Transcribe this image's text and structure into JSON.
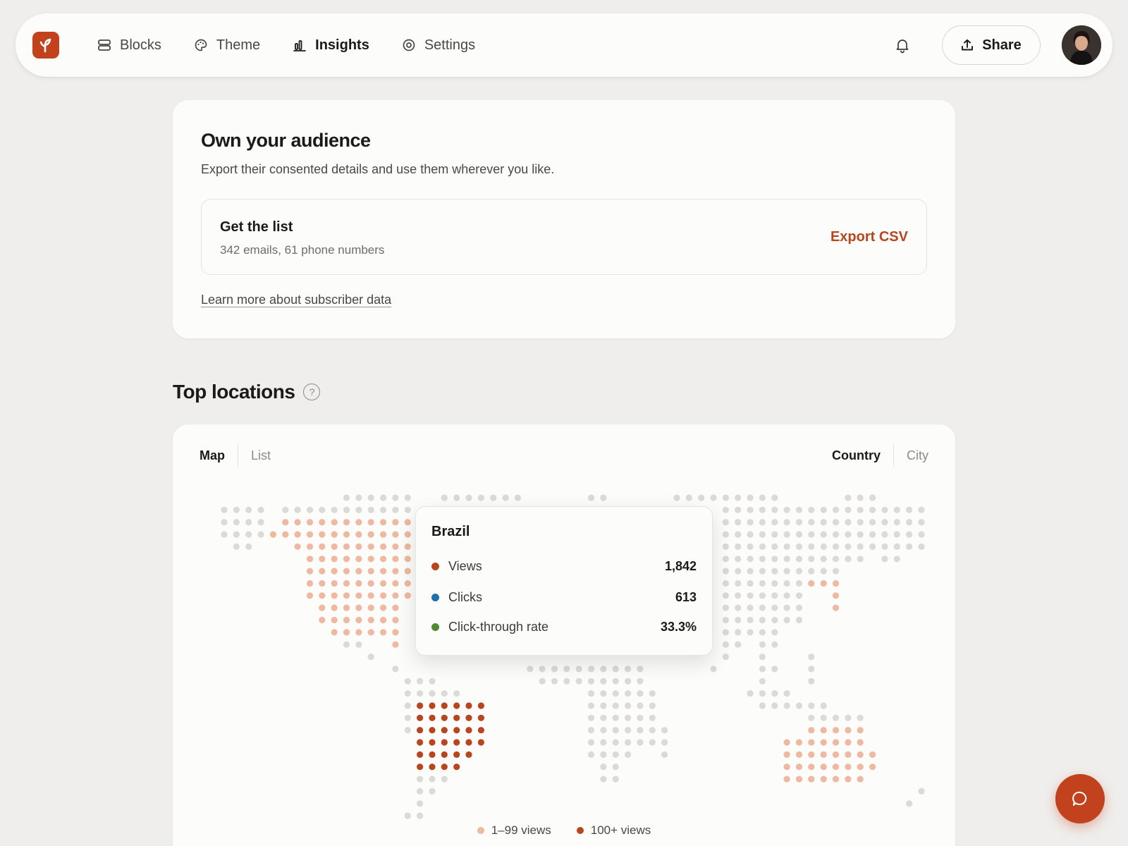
{
  "nav": {
    "items": [
      {
        "label": "Blocks",
        "icon": "blocks-icon",
        "active": false
      },
      {
        "label": "Theme",
        "icon": "palette-icon",
        "active": false
      },
      {
        "label": "Insights",
        "icon": "bar-chart-icon",
        "active": true
      },
      {
        "label": "Settings",
        "icon": "gear-icon",
        "active": false
      }
    ],
    "share_label": "Share"
  },
  "audience": {
    "title": "Own your audience",
    "subtitle": "Export their consented details and use them wherever you like.",
    "list_title": "Get the list",
    "list_summary": "342 emails, 61 phone numbers",
    "export_label": "Export CSV",
    "learn_more": "Learn more about subscriber data"
  },
  "locations": {
    "title": "Top locations",
    "help": "?",
    "view_tabs": [
      "Map",
      "List"
    ],
    "view_active": "Map",
    "scope_tabs": [
      "Country",
      "City"
    ],
    "scope_active": "Country",
    "tooltip": {
      "country": "Brazil",
      "rows": [
        {
          "label": "Views",
          "value": "1,842",
          "color": "#b9451f"
        },
        {
          "label": "Clicks",
          "value": "613",
          "color": "#1f6fa8"
        },
        {
          "label": "Click-through rate",
          "value": "33.3%",
          "color": "#4f8a2e"
        }
      ]
    },
    "legend": [
      {
        "label": "1–99 views",
        "color": "#efb8a0"
      },
      {
        "label": "100+ views",
        "color": "#b9451f"
      }
    ],
    "colors": {
      "none": "#dcdad7",
      "low": "#efb8a0",
      "high": "#b9451f"
    }
  },
  "colors": {
    "accent": "#c2421d",
    "background": "#efeeec",
    "card": "#fcfcfb"
  }
}
